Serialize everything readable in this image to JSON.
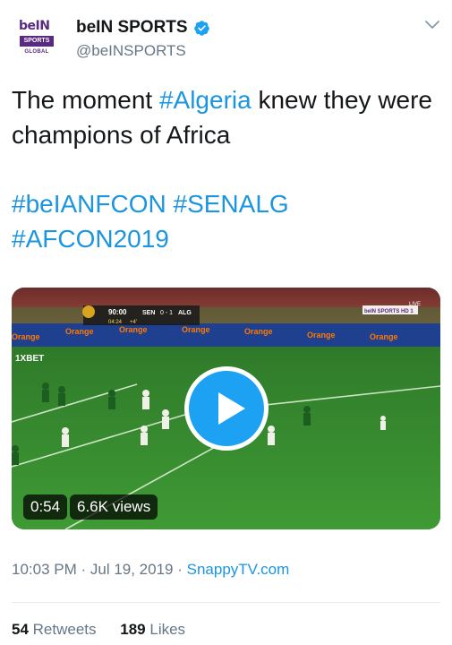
{
  "author": {
    "display_name": "beIN SPORTS",
    "handle": "@beINSPORTS",
    "verified": true,
    "avatar_logo_top": "beIN",
    "avatar_logo_middle": "SPORTS",
    "avatar_logo_bottom": "GLOBAL"
  },
  "tweet": {
    "text_part1": "The moment ",
    "hashtag_algeria": "#Algeria",
    "text_part2": " knew they were champions of Africa",
    "hashtag_line1": "#beIANFCON #SENALG",
    "hashtag_line2": "#AFCON2019"
  },
  "media": {
    "duration": "0:54",
    "views": "6.6K views",
    "scoreboard_time": "90:00",
    "scoreboard_extra": "04:24",
    "scoreboard_added": "+4'",
    "scoreboard_team1": "SEN",
    "scoreboard_score": "0 - 1",
    "scoreboard_team2": "ALG",
    "ad_text": "Orange",
    "ad_text2": "1XBET",
    "channel_logo": "beIN SPORTS HD 1",
    "live_text": "LIVE"
  },
  "meta": {
    "time": "10:03 PM",
    "separator": " · ",
    "date": "Jul 19, 2019",
    "source": "SnappyTV.com"
  },
  "stats": {
    "retweets_count": "54",
    "retweets_label": "Retweets",
    "likes_count": "189",
    "likes_label": "Likes"
  },
  "colors": {
    "link": "#1b95e0",
    "secondary_text": "#657786",
    "play_button": "#1da1f2",
    "pitch": "#3b8a2e"
  },
  "icons": [
    "verified-badge-icon",
    "chevron-down-icon",
    "play-icon"
  ]
}
